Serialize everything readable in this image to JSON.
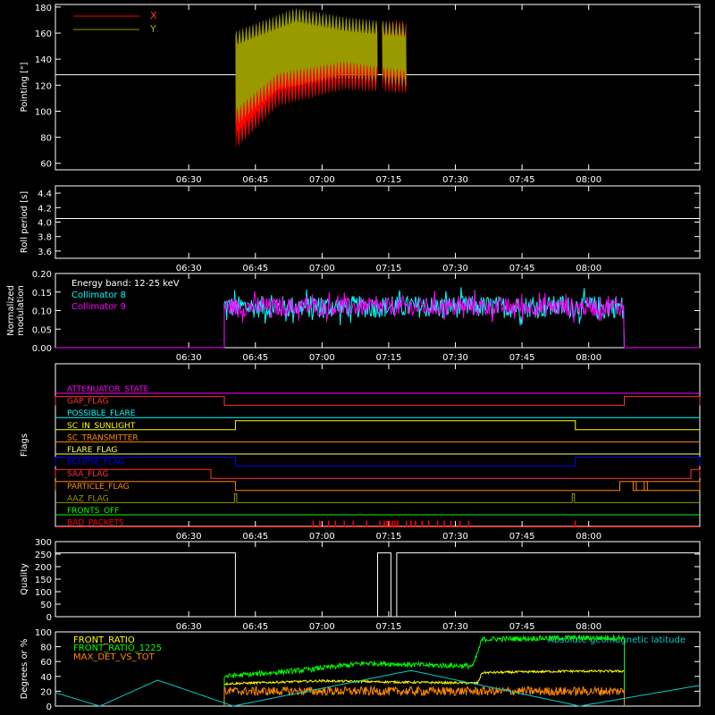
{
  "colors": {
    "background": "#000000",
    "axis": "#ffffff",
    "x_pointing": "#ff0000",
    "y_pointing": "#999900",
    "collimator8": "#00ffff",
    "collimator9": "#ff00ff",
    "front_ratio": "#ffff00",
    "front_ratio_1225": "#00ff00",
    "max_det": "#ff8800",
    "geomag": "#00cccc"
  },
  "chart_data": [
    {
      "id": "pointing",
      "type": "area",
      "xlabel": "",
      "ylabel": "Pointing [\"]",
      "ylim": [
        55,
        182
      ],
      "yticks": [
        60,
        80,
        100,
        120,
        140,
        160,
        180
      ],
      "xtick_labels": [
        "06:30",
        "06:45",
        "07:00",
        "07:15",
        "07:30",
        "07:45",
        "08:00"
      ],
      "xlim_min": [
        360,
        488
      ],
      "reference_line": 128,
      "legend": [
        "X",
        "Y"
      ],
      "legend_position": "top-left",
      "segments": [
        [
          400.5,
          432.5
        ],
        [
          433.5,
          439
        ]
      ],
      "series": [
        {
          "name": "X",
          "envelope_min": [
            [
              400.5,
              70
            ],
            [
              410,
              103
            ],
            [
              425,
              116
            ],
            [
              439,
              113
            ]
          ],
          "envelope_max": [
            [
              400.5,
              160
            ],
            [
              425,
              170
            ],
            [
              439,
              170
            ]
          ]
        },
        {
          "name": "Y",
          "envelope_min": [
            [
              400.5,
              88
            ],
            [
              410,
              116
            ],
            [
              425,
              125
            ],
            [
              439,
              118
            ]
          ],
          "envelope_max": [
            [
              400.5,
              162
            ],
            [
              414,
              180
            ],
            [
              425,
              173
            ],
            [
              439,
              168
            ]
          ]
        }
      ]
    },
    {
      "id": "roll",
      "type": "line",
      "ylabel": "Roll period [s]",
      "ylim": [
        3.5,
        4.5
      ],
      "yticks": [
        3.6,
        3.8,
        4.0,
        4.2,
        4.4
      ],
      "ytick_labels": [
        "3.6",
        "3.8",
        "4.0",
        "4.2",
        "4.4"
      ],
      "xtick_labels": [
        "06:30",
        "06:45",
        "07:00",
        "07:15",
        "07:30",
        "07:45",
        "08:00"
      ],
      "value": 4.05
    },
    {
      "id": "modulation",
      "type": "line",
      "ylabel": "Normalized modulation",
      "ylabel_lines": [
        "Normalized",
        "modulation"
      ],
      "ylim": [
        0,
        0.2
      ],
      "yticks": [
        0,
        0.05,
        0.1,
        0.15,
        0.2
      ],
      "ytick_labels": [
        "0.00",
        "0.05",
        "0.10",
        "0.15",
        "0.20"
      ],
      "xtick_labels": [
        "06:30",
        "06:45",
        "07:00",
        "07:15",
        "07:30",
        "07:45",
        "08:00"
      ],
      "annotation": "Energy band: 12-25 keV",
      "active_range": [
        398,
        488
      ],
      "series": [
        {
          "name": "Collimator 8",
          "level": 0.11,
          "noise": 0.03
        },
        {
          "name": "Collimator 9",
          "level": 0.11,
          "noise": 0.025
        }
      ]
    },
    {
      "id": "flags",
      "type": "line",
      "ylabel": "Flags",
      "xtick_labels": [
        "06:30",
        "06:45",
        "07:00",
        "07:15",
        "07:30",
        "07:45",
        "08:00"
      ],
      "flags": [
        {
          "name": "ATTENUATOR_STATE",
          "color": "#ff00ff",
          "on": []
        },
        {
          "name": "GAP_FLAG",
          "color": "#ff3333",
          "on": [
            [
              360,
              398
            ],
            [
              488,
              505
            ]
          ]
        },
        {
          "name": "POSSIBLE_FLARE",
          "color": "#00ffff",
          "on": []
        },
        {
          "name": "SC_IN_SUNLIGHT",
          "color": "#ffff00",
          "on": [
            [
              400.5,
              477
            ]
          ]
        },
        {
          "name": "SC_TRANSMITTER",
          "color": "#ff8800",
          "on": []
        },
        {
          "name": "FLARE_FLAG",
          "color": "#ffff55",
          "on": []
        },
        {
          "name": "ECLIPSE_FLAG",
          "color": "#0000ff",
          "on": [
            [
              360,
              400.5
            ],
            [
              477,
              505
            ]
          ]
        },
        {
          "name": "SAA_FLAG",
          "color": "#ff3333",
          "on": [
            [
              360,
              395
            ],
            [
              503,
              505
            ]
          ]
        },
        {
          "name": "PARTICLE_FLAG",
          "color": "#ff8800",
          "on": [
            [
              360,
              400.5
            ],
            [
              487,
              505
            ],
            [
              490,
              490.7
            ],
            [
              492.5,
              493.2
            ]
          ]
        },
        {
          "name": "AAZ_FLAG",
          "color": "#999900",
          "on": [
            [
              400.3,
              400.8
            ],
            [
              476.3,
              476.8
            ]
          ]
        },
        {
          "name": "FRONTS_OFF",
          "color": "#00ff00",
          "on": []
        },
        {
          "name": "BAD_PACKETS",
          "color": "#ff0000",
          "on": [],
          "spikes": [
            418,
            419.5,
            421.5,
            423,
            425,
            427,
            430,
            433,
            434,
            434.6,
            435.2,
            435.8,
            436.4,
            437,
            439,
            440,
            441,
            442.5,
            444,
            446,
            447.5,
            449,
            451,
            453,
            477
          ]
        }
      ]
    },
    {
      "id": "quality",
      "type": "line",
      "ylabel": "Quality",
      "ylim": [
        0,
        300
      ],
      "yticks": [
        0,
        50,
        100,
        150,
        200,
        250,
        300
      ],
      "ytick_labels": [
        "0",
        "50",
        "100",
        "150",
        "200",
        "250",
        "300"
      ],
      "xtick_labels": [
        "06:30",
        "06:45",
        "07:00",
        "07:15",
        "07:30",
        "07:45",
        "08:00"
      ],
      "steps": [
        [
          360,
          255
        ],
        [
          400.5,
          0
        ],
        [
          432.5,
          255
        ],
        [
          435.5,
          0
        ],
        [
          436.8,
          255
        ],
        [
          505,
          255
        ]
      ]
    },
    {
      "id": "ratios",
      "type": "line",
      "ylabel": "Degrees or %",
      "ylim": [
        0,
        100
      ],
      "yticks": [
        0,
        20,
        40,
        60,
        80,
        100
      ],
      "ytick_labels": [
        "0",
        "20",
        "40",
        "60",
        "80",
        "100"
      ],
      "annotation": "Absolute geomagnetic latitude",
      "series": [
        {
          "name": "FRONT_RATIO",
          "color_key": "front_ratio",
          "range": [
            398,
            488
          ],
          "profile": [
            [
              398,
              30
            ],
            [
              420,
              34
            ],
            [
              440,
              32
            ],
            [
              455,
              31
            ],
            [
              456,
              45
            ],
            [
              475,
              47
            ],
            [
              488,
              47
            ]
          ],
          "noise": 1.5
        },
        {
          "name": "FRONT_RATIO_1225",
          "color_key": "front_ratio_1225",
          "range": [
            398,
            488
          ],
          "profile": [
            [
              398,
              40
            ],
            [
              415,
              48
            ],
            [
              430,
              58
            ],
            [
              445,
              55
            ],
            [
              454,
              54
            ],
            [
              456,
              90
            ],
            [
              475,
              92
            ],
            [
              488,
              92
            ]
          ],
          "noise": 3.5
        },
        {
          "name": "MAX_DET_VS_TOT",
          "color_key": "max_det",
          "range": [
            398,
            488
          ],
          "profile": [
            [
              398,
              20
            ],
            [
              430,
              20
            ],
            [
              460,
              20
            ],
            [
              488,
              20
            ]
          ],
          "noise": 6
        },
        {
          "name": "Absolute geomagnetic latitude",
          "color_key": "geomag",
          "curve": [
            [
              360,
              18
            ],
            [
              370,
              0
            ],
            [
              383,
              35
            ],
            [
              400,
              0
            ],
            [
              440,
              48
            ],
            [
              478,
              0
            ],
            [
              505,
              28
            ]
          ]
        }
      ]
    }
  ]
}
